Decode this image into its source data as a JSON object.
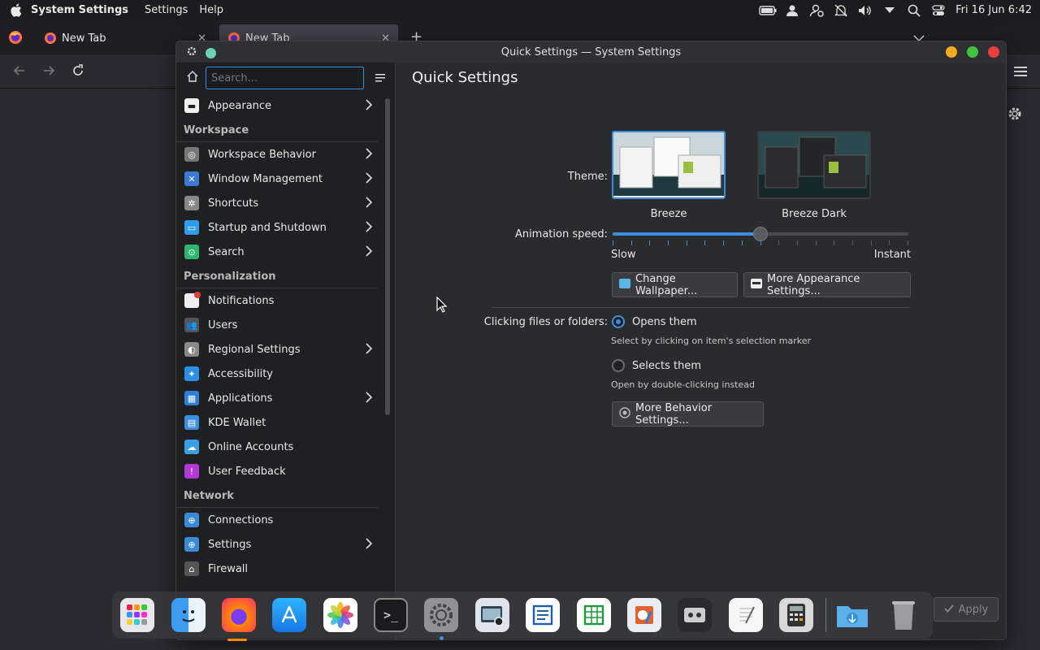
{
  "menubar": {
    "app_name": "System Settings",
    "menus": [
      "Settings",
      "Help"
    ],
    "clock": "Fri 16 Jun  6:42"
  },
  "browser": {
    "tabs": [
      {
        "label": "New Tab"
      },
      {
        "label": "New Tab"
      }
    ]
  },
  "window": {
    "title": "Quick Settings — System Settings"
  },
  "sidebar": {
    "search_placeholder": "Search...",
    "top_items": [
      {
        "label": "Appearance",
        "icon": "appearance-icon",
        "chevron": true
      }
    ],
    "sections": [
      {
        "title": "Workspace",
        "items": [
          {
            "label": "Workspace Behavior",
            "icon": "workspace-behavior-icon",
            "chevron": true
          },
          {
            "label": "Window Management",
            "icon": "window-management-icon",
            "chevron": true
          },
          {
            "label": "Shortcuts",
            "icon": "shortcuts-icon",
            "chevron": true
          },
          {
            "label": "Startup and Shutdown",
            "icon": "startup-icon",
            "chevron": true
          },
          {
            "label": "Search",
            "icon": "search-icon",
            "chevron": true
          }
        ]
      },
      {
        "title": "Personalization",
        "items": [
          {
            "label": "Notifications",
            "icon": "notifications-icon",
            "chevron": false
          },
          {
            "label": "Users",
            "icon": "users-icon",
            "chevron": false
          },
          {
            "label": "Regional Settings",
            "icon": "regional-settings-icon",
            "chevron": true
          },
          {
            "label": "Accessibility",
            "icon": "accessibility-icon",
            "chevron": false
          },
          {
            "label": "Applications",
            "icon": "applications-icon",
            "chevron": true
          },
          {
            "label": "KDE Wallet",
            "icon": "wallet-icon",
            "chevron": false
          },
          {
            "label": "Online Accounts",
            "icon": "online-accounts-icon",
            "chevron": false
          },
          {
            "label": "User Feedback",
            "icon": "feedback-icon",
            "chevron": false
          }
        ]
      },
      {
        "title": "Network",
        "items": [
          {
            "label": "Connections",
            "icon": "connections-icon",
            "chevron": false
          },
          {
            "label": "Settings",
            "icon": "network-settings-icon",
            "chevron": true
          },
          {
            "label": "Firewall",
            "icon": "firewall-icon",
            "chevron": false
          }
        ]
      }
    ]
  },
  "main": {
    "title": "Quick Settings",
    "theme_label": "Theme:",
    "themes": [
      {
        "name": "Breeze",
        "selected": true
      },
      {
        "name": "Breeze Dark",
        "selected": false
      }
    ],
    "animation_label": "Animation speed:",
    "animation_slow": "Slow",
    "animation_instant": "Instant",
    "animation_value": 0.5,
    "change_wallpaper": "Change Wallpaper...",
    "more_appearance": "More Appearance Settings...",
    "clicking_label": "Clicking files or folders:",
    "opens_them": "Opens them",
    "opens_hint": "Select by clicking on item's selection marker",
    "selects_them": "Selects them",
    "selects_hint": "Open by double-clicking instead",
    "more_behavior": "More Behavior Settings...",
    "apply": "Apply"
  },
  "dock": {
    "apps": [
      "launchpad-icon",
      "finder-icon",
      "firefox-icon",
      "app-store-icon",
      "photos-icon",
      "terminal-icon",
      "system-settings-icon",
      "screenshot-icon",
      "writer-icon",
      "calc-icon",
      "draw-icon",
      "media-icon",
      "text-editor-icon",
      "calculator-icon",
      "downloads-folder-icon",
      "trash-icon"
    ]
  },
  "colors": {
    "accent": "#3d8ee0",
    "sidebar_bg": "#1f2022",
    "window_bg": "#2a2b2d"
  }
}
